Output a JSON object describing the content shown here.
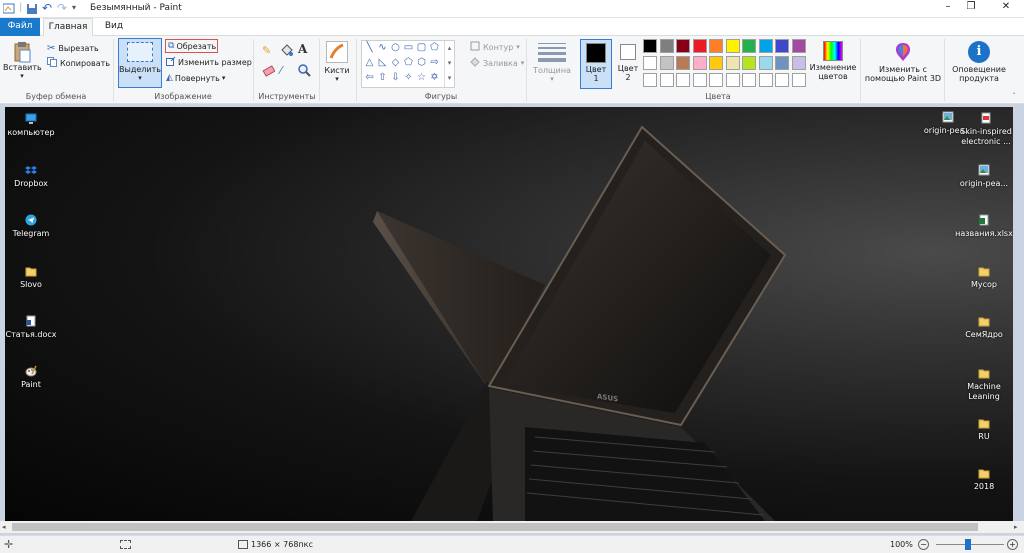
{
  "window": {
    "title": "Безымянный - Paint",
    "qat_separator": "|",
    "min": "–",
    "max": "❐",
    "close": "✕"
  },
  "tabs": [
    {
      "label": "Файл"
    },
    {
      "label": "Главная"
    },
    {
      "label": "Вид"
    }
  ],
  "ribbon": {
    "clipboard": {
      "paste": "Вставить",
      "cut": "Вырезать",
      "copy": "Копировать",
      "group": "Буфер обмена"
    },
    "image": {
      "select": "Выделить",
      "crop": "Обрезать",
      "resize": "Изменить размер",
      "rotate": "Повернуть",
      "group": "Изображение"
    },
    "tools": {
      "group": "Инструменты",
      "text_tool": "A"
    },
    "brushes": {
      "label": "Кисти"
    },
    "shapes": {
      "outline": "Контур",
      "fill": "Заливка",
      "group": "Фигуры"
    },
    "size": {
      "label": "Толщина"
    },
    "colors": {
      "color1": "Цвет",
      "color1_n": "1",
      "color2": "Цвет",
      "color2_n": "2",
      "edit": "Изменение цветов",
      "group": "Цвета",
      "palette": [
        "#000000",
        "#7f7f7f",
        "#880015",
        "#ed1c24",
        "#ff7f27",
        "#fff200",
        "#22b14c",
        "#00a2e8",
        "#3f48cc",
        "#a349a4",
        "#ffffff",
        "#c3c3c3",
        "#b97a57",
        "#ffaec9",
        "#ffc90e",
        "#efe4b0",
        "#b5e61d",
        "#99d9ea",
        "#7092be",
        "#c8bfe7",
        "#ffffff",
        "#ffffff",
        "#ffffff",
        "#ffffff",
        "#ffffff",
        "#ffffff",
        "#ffffff",
        "#ffffff",
        "#ffffff",
        "#ffffff"
      ]
    },
    "paint3d": "Изменить с помощью Paint 3D",
    "product_alert": "Оповещение продукта"
  },
  "desktop": {
    "left_icons": [
      {
        "label": "компьютер",
        "icon": "computer-icon"
      },
      {
        "label": "Dropbox",
        "icon": "dropbox-icon"
      },
      {
        "label": "Telegram",
        "icon": "telegram-icon"
      },
      {
        "label": "Slovo",
        "icon": "folder-icon"
      },
      {
        "label": "Статья.docx",
        "icon": "document-icon"
      },
      {
        "label": "Paint",
        "icon": "paint-icon"
      }
    ],
    "right_icons": [
      {
        "label": "origin-pea...",
        "icon": "image-file-icon"
      },
      {
        "label": "Skin-inspired electronic ...",
        "icon": "pdf-icon"
      },
      {
        "label": "origin-pea...",
        "icon": "image-file-icon"
      },
      {
        "label": "названия.xlsx",
        "icon": "excel-icon"
      },
      {
        "label": "Мусор",
        "icon": "folder-icon"
      },
      {
        "label": "СемЯдро",
        "icon": "folder-icon"
      },
      {
        "label": "Machine Leaning",
        "icon": "folder-icon"
      },
      {
        "label": "RU",
        "icon": "folder-icon"
      },
      {
        "label": "2018",
        "icon": "folder-icon"
      }
    ],
    "laptop_logo": "ASUS"
  },
  "status": {
    "dimensions": "1366 × 768пкс",
    "zoom": "100%",
    "zoom_minus": "−",
    "zoom_plus": "+"
  }
}
